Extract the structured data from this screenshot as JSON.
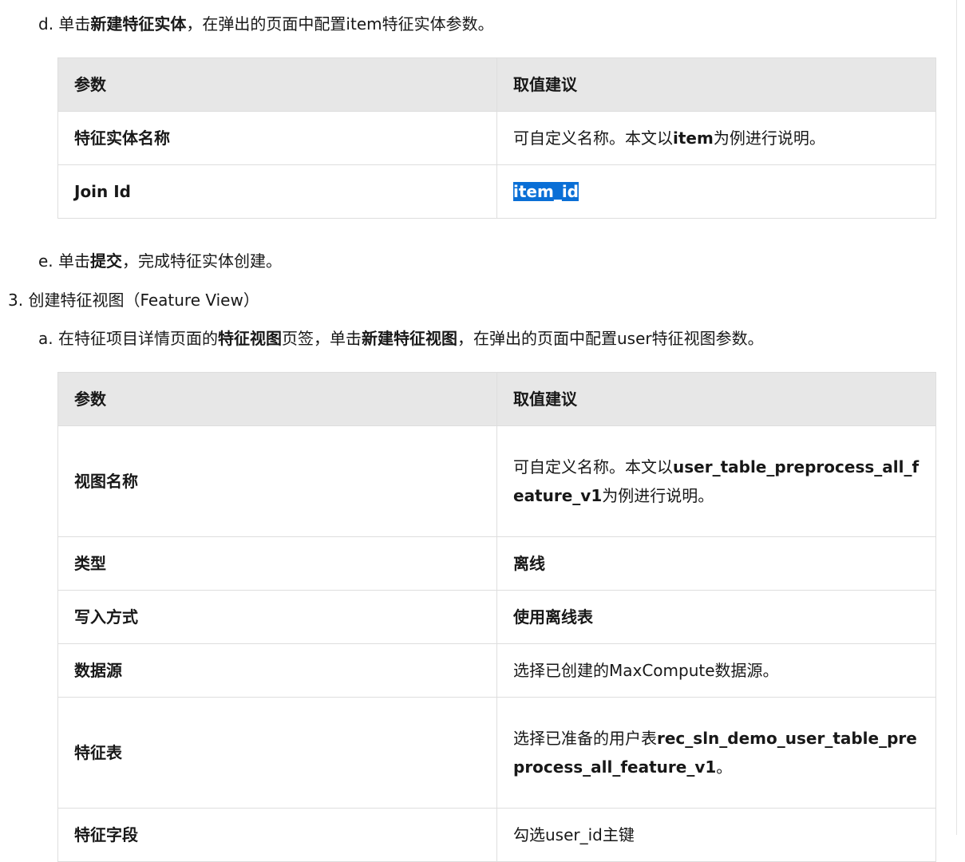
{
  "steps": {
    "d": {
      "prefix": "d. 单击",
      "bold": "新建特征实体",
      "suffix": "，在弹出的页面中配置item特征实体参数。"
    },
    "e": {
      "prefix": "e. 单击",
      "bold": "提交",
      "suffix": "，完成特征实体创建。"
    },
    "s3": {
      "text": "3. 创建特征视图（Feature View）"
    },
    "a": {
      "prefix": "a. 在特征项目详情页面的",
      "bold1": "特征视图",
      "mid": "页签，单击",
      "bold2": "新建特征视图",
      "suffix": "，在弹出的页面中配置user特征视图参数。"
    }
  },
  "table1": {
    "headers": [
      "参数",
      "取值建议"
    ],
    "row1": {
      "name": "特征实体名称",
      "value_prefix": "可自定义名称。本文以",
      "value_bold": "item",
      "value_suffix": "为例进行说明。"
    },
    "row2": {
      "name": "Join Id",
      "value": "item_id"
    }
  },
  "table2": {
    "headers": [
      "参数",
      "取值建议"
    ],
    "rows": [
      {
        "name": "视图名称",
        "value_prefix": "可自定义名称。本文以",
        "value_bold": "user_table_preprocess_all_feature_v1",
        "value_suffix": "为例进行说明。"
      },
      {
        "name": "类型",
        "value": "离线"
      },
      {
        "name": "写入方式",
        "value": "使用离线表"
      },
      {
        "name": "数据源",
        "value": "选择已创建的MaxCompute数据源。"
      },
      {
        "name": "特征表",
        "value_prefix": "选择已准备的用户表",
        "value_bold": "rec_sln_demo_user_table_preprocess_all_feature_v1",
        "value_suffix": "。"
      },
      {
        "name": "特征字段",
        "value": "勾选user_id主键"
      }
    ]
  }
}
